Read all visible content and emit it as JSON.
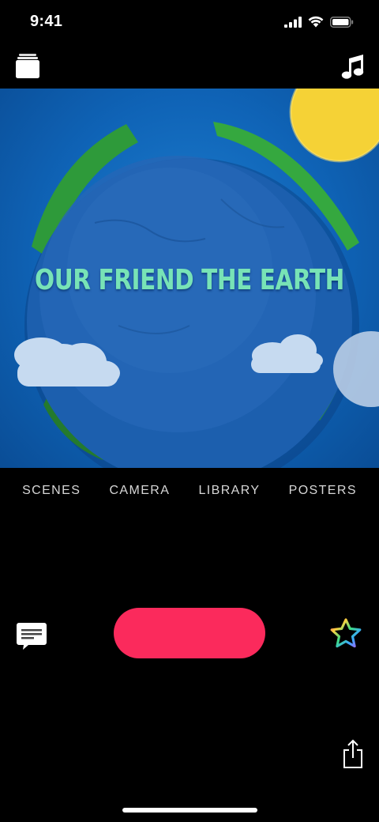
{
  "status_bar": {
    "time": "9:41"
  },
  "preview": {
    "title": "OUR FRIEND THE EARTH"
  },
  "tabs": [
    {
      "label": "SCENES"
    },
    {
      "label": "CAMERA"
    },
    {
      "label": "LIBRARY"
    },
    {
      "label": "POSTERS"
    }
  ],
  "icons": {
    "top_left": "projects-icon",
    "top_right": "music-note-icon",
    "bottom_left": "title-text-icon",
    "bottom_right": "star-sticker-icon",
    "bottom_right_lower": "share-icon"
  },
  "colors": {
    "background": "#000000",
    "record_button": "#fb2a5c",
    "title_text": "#78e3b6",
    "tab_text": "#d7d7d7"
  }
}
